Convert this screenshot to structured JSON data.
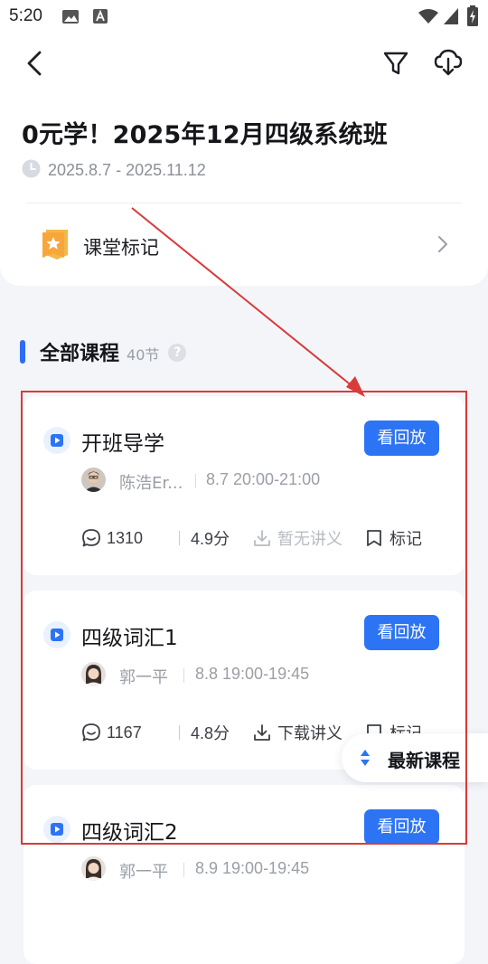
{
  "status_bar": {
    "time": "5:20"
  },
  "header": {
    "title": "0元学！2025年12月四级系统班",
    "date_range": "2025.8.7 - 2025.11.12",
    "class_marks_label": "课堂标记"
  },
  "section": {
    "title": "全部课程",
    "count": "40节",
    "help": "?"
  },
  "courses": [
    {
      "title": "开班导学",
      "replay_label": "看回放",
      "teacher": "陈浩Er...",
      "time": "8.7 20:00-21:00",
      "comments": "1310",
      "rating": "4.9分",
      "handout": "暂无讲义",
      "handout_available": false,
      "mark_label": "标记"
    },
    {
      "title": "四级词汇1",
      "replay_label": "看回放",
      "teacher": "郭一平",
      "time": "8.8 19:00-19:45",
      "comments": "1167",
      "rating": "4.8分",
      "handout": "下载讲义",
      "handout_available": true,
      "mark_label": "标记"
    },
    {
      "title": "四级词汇2",
      "replay_label": "看回放",
      "teacher": "郭一平",
      "time": "8.9 19:00-19:45"
    }
  ],
  "floating_button": {
    "label": "最新课程"
  },
  "colors": {
    "accent": "#2d74f5",
    "annotation": "#d93a3a",
    "page_bg": "#f3f5f8"
  }
}
